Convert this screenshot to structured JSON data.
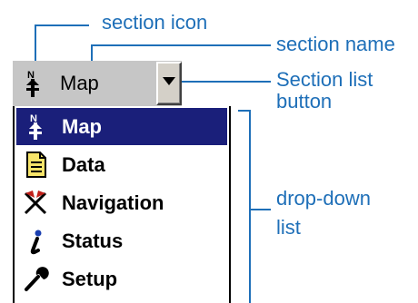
{
  "annotations": {
    "section_icon": "section icon",
    "section_name": "section name",
    "section_list_button": [
      "Section list",
      "button"
    ],
    "dropdown_list": [
      "drop-down",
      "list"
    ]
  },
  "selector": {
    "current_section": "Map",
    "icon": "map-north-icon",
    "button_icon": "dropdown-arrow-icon"
  },
  "dropdown": {
    "items": [
      {
        "label": "Map",
        "icon": "map-north-icon",
        "selected": true
      },
      {
        "label": "Data",
        "icon": "document-icon",
        "selected": false
      },
      {
        "label": "Navigation",
        "icon": "navigation-flags-icon",
        "selected": false
      },
      {
        "label": "Status",
        "icon": "info-icon",
        "selected": false
      },
      {
        "label": "Setup",
        "icon": "wrench-icon",
        "selected": false
      }
    ]
  },
  "colors": {
    "callout": "#1e6fb8",
    "selection": "#1a1f7a",
    "combo_background": "#c6c6c6"
  }
}
